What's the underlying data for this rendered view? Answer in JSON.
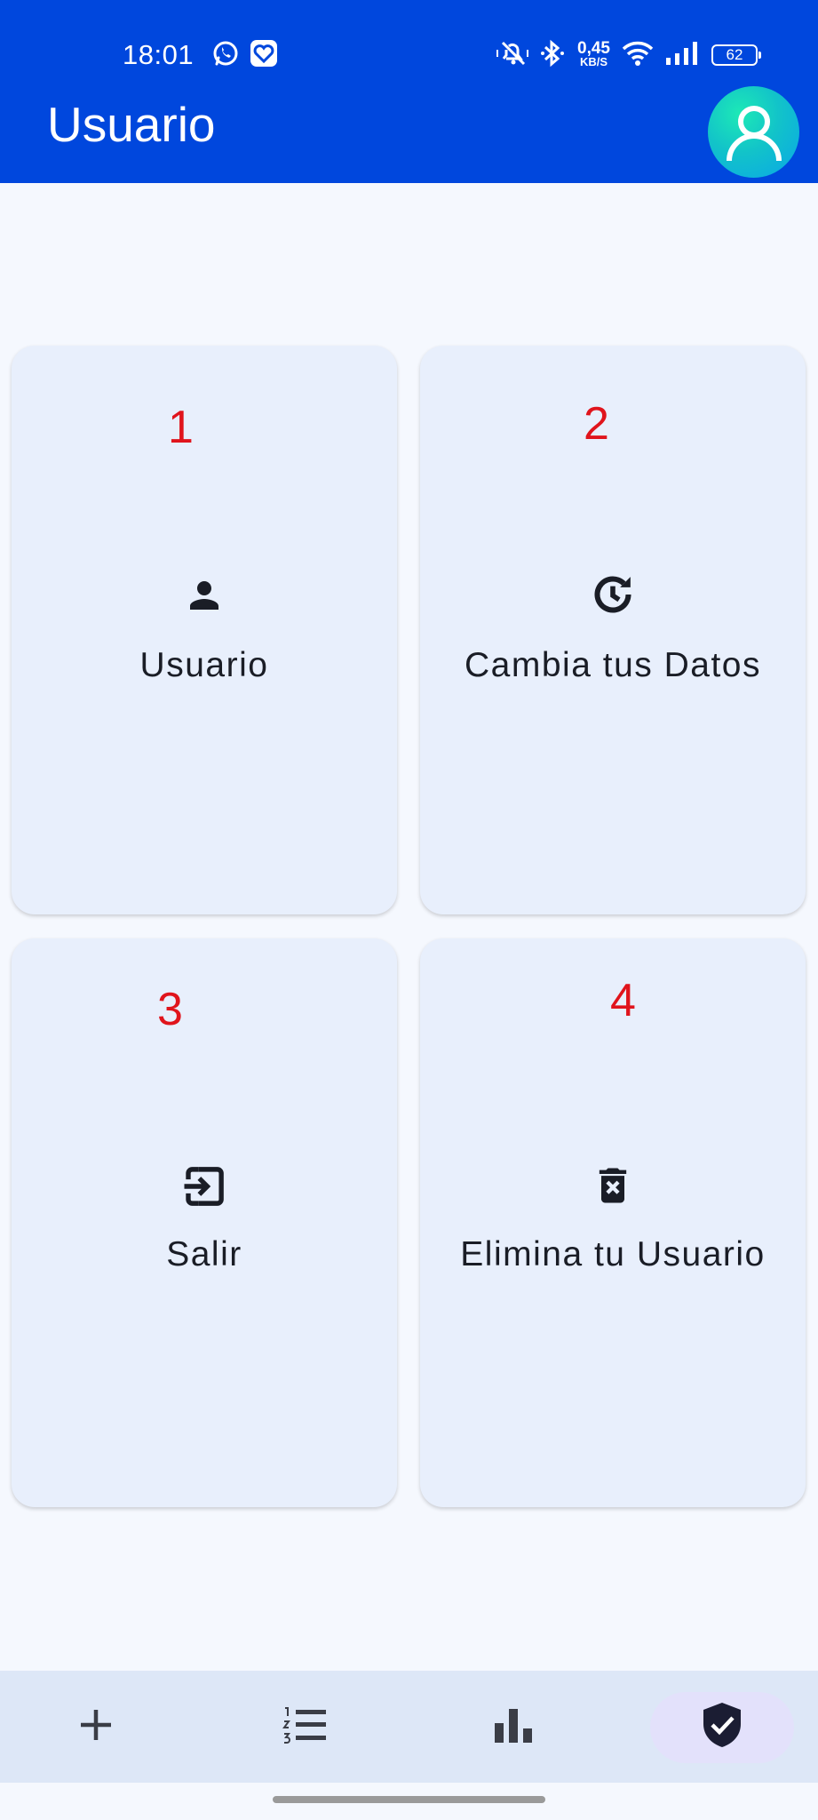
{
  "status_bar": {
    "time": "18:01",
    "net_speed_value": "0,45",
    "net_speed_unit": "KB/S",
    "battery": "62",
    "icons": [
      "whatsapp-icon",
      "heart-app-icon",
      "mute-icon",
      "bluetooth-icon",
      "wifi-icon",
      "signal-icon",
      "battery-icon"
    ]
  },
  "header": {
    "title": "Usuario",
    "avatar_icon": "user-avatar-icon"
  },
  "colors": {
    "app_bar": "#0047dd",
    "card_bg": "#e8effc",
    "page_bg": "#f5f8fe",
    "annotation": "#e0141c",
    "nav_bg": "#dde7f7",
    "nav_active": "#e3e1fb"
  },
  "cards": [
    {
      "number": "1",
      "label": "Usuario",
      "icon": "person-icon"
    },
    {
      "number": "2",
      "label": "Cambia tus Datos",
      "icon": "history-icon"
    },
    {
      "number": "3",
      "label": "Salir",
      "icon": "logout-icon"
    },
    {
      "number": "4",
      "label": "Elimina tu Usuario",
      "icon": "delete-icon"
    }
  ],
  "bottom_nav": {
    "items": [
      {
        "icon": "add-icon"
      },
      {
        "icon": "numbered-list-icon"
      },
      {
        "icon": "bar-chart-icon"
      },
      {
        "icon": "verified-shield-icon",
        "active": true
      }
    ]
  }
}
